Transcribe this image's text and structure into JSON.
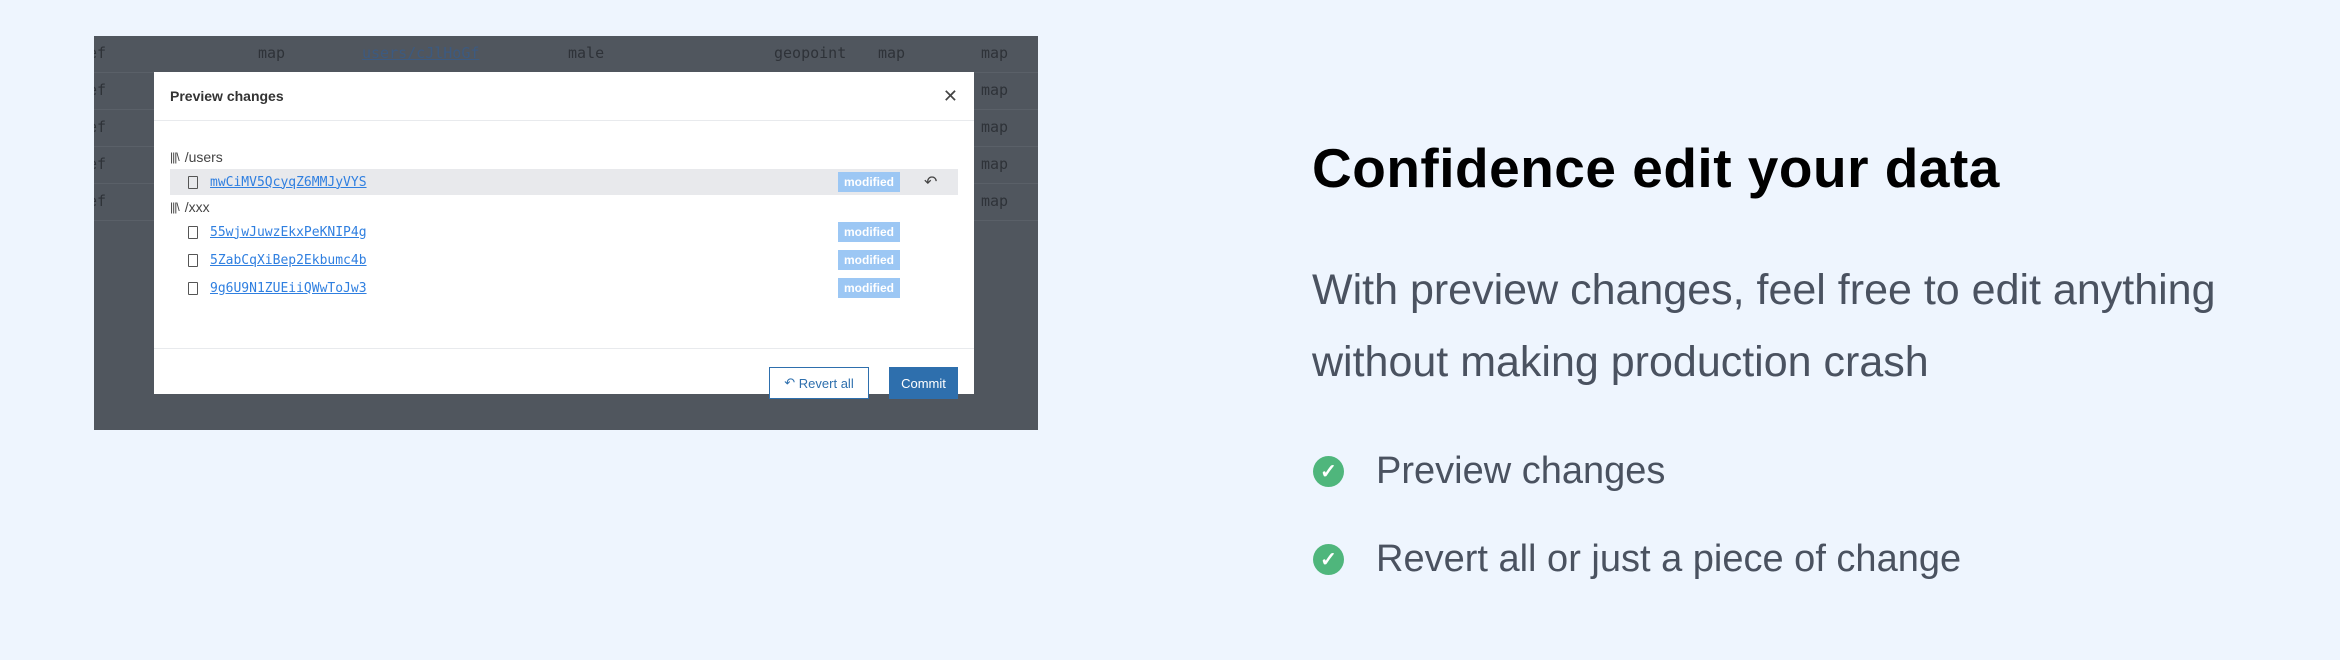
{
  "background_table": {
    "rows": [
      [
        "ef",
        "map",
        "users/cJlHoGf",
        "male",
        "geopoint",
        "map",
        "map"
      ],
      [
        "ef",
        "",
        "",
        "",
        "",
        "",
        "map"
      ],
      [
        "ef",
        "",
        "",
        "",
        "",
        "",
        "map"
      ],
      [
        "ef",
        "",
        "",
        "",
        "",
        "",
        "map"
      ],
      [
        "ef",
        "",
        "",
        "",
        "",
        "",
        "map"
      ]
    ]
  },
  "modal": {
    "title": "Preview changes",
    "close_icon": "close-icon",
    "collections": [
      {
        "name": "/users",
        "docs": [
          {
            "id": "mwCiMV5QcyqZ6MMJyVYS",
            "status": "modified",
            "selected": true
          }
        ]
      },
      {
        "name": "/xxx",
        "docs": [
          {
            "id": "55wjwJuwzEkxPeKNIP4g",
            "status": "modified"
          },
          {
            "id": "5ZabCqXiBep2Ekbumc4b",
            "status": "modified"
          },
          {
            "id": "9g6U9N1ZUEiiQWwToJw3",
            "status": "modified"
          }
        ]
      }
    ],
    "revert_all_label": "Revert all",
    "commit_label": "Commit"
  },
  "hero": {
    "title": "Confidence edit your data",
    "description": "With preview changes, feel free to edit anything without making production crash",
    "features": [
      "Preview changes",
      "Revert all or just a piece of change"
    ]
  },
  "colors": {
    "accent": "#2e6fad",
    "badge": "#9cc7f4",
    "check": "#4fb67c",
    "background": "#eef5fe"
  }
}
